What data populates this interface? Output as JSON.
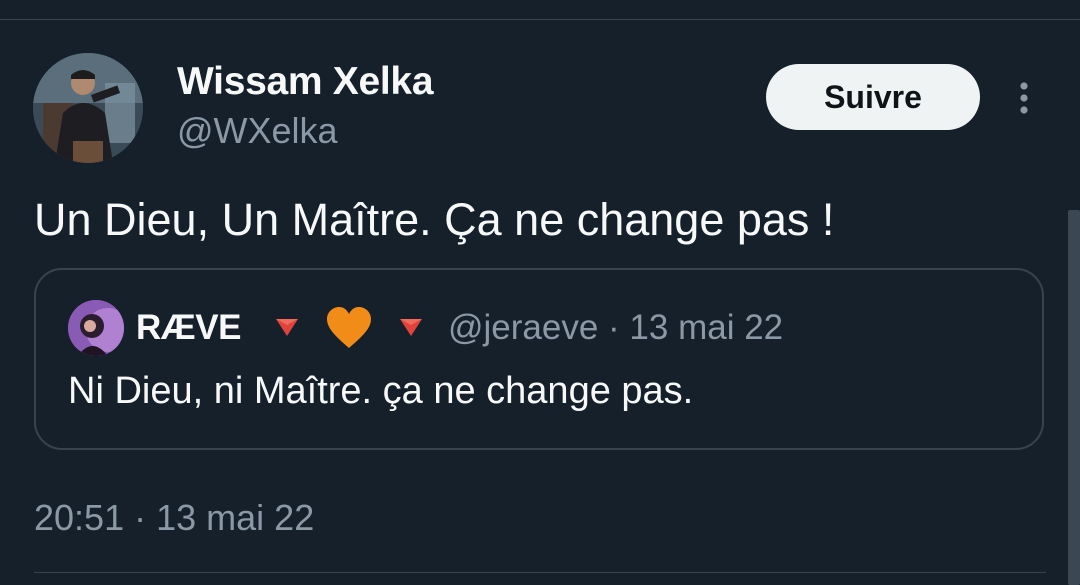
{
  "author": {
    "display_name": "Wissam Xelka",
    "handle": "@WXelka",
    "avatar_icon": "profile-photo"
  },
  "actions": {
    "follow_label": "Suivre",
    "more_icon": "vertical-ellipsis-icon"
  },
  "tweet": {
    "text": "Un Dieu, Un Maître. Ça ne change pas !",
    "time": "20:51",
    "separator": "·",
    "date": "13 mai 22"
  },
  "quoted_tweet": {
    "display_name": "RÆVE",
    "name_emojis": [
      "red-triangle-down",
      "orange-heart",
      "red-triangle-down"
    ],
    "handle_date": "@jeraeve · 13 mai 22",
    "text": "Ni Dieu, ni Maître. ça ne change pas."
  },
  "colors": {
    "background": "#15202b",
    "divider": "#38444d",
    "secondary_text": "#8b98a5",
    "follow_button_bg": "#eff3f4",
    "emoji_triangle": "#e0433a",
    "emoji_heart": "#f28c18"
  }
}
